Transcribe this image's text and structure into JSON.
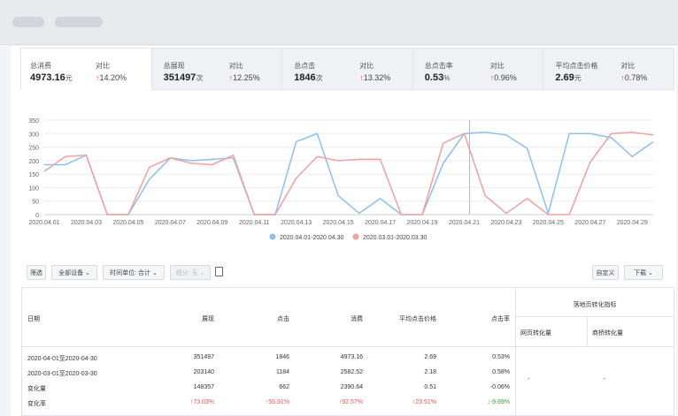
{
  "kpis": [
    {
      "label": "总消费",
      "value": "4973.16",
      "unit": "元",
      "compare_label": "对比",
      "arrow": "↑",
      "change": "14.20%"
    },
    {
      "label": "总展现",
      "value": "351497",
      "unit": "次",
      "compare_label": "对比",
      "arrow": "↑",
      "change": "12.25%"
    },
    {
      "label": "总点击",
      "value": "1846",
      "unit": "次",
      "compare_label": "对比",
      "arrow": "↑",
      "change": "13.32%"
    },
    {
      "label": "总点击率",
      "value": "0.53",
      "unit": "%",
      "compare_label": "对比",
      "arrow": "↑",
      "change": "0.96%"
    },
    {
      "label": "平均点击价格",
      "value": "2.69",
      "unit": "元",
      "compare_label": "对比",
      "arrow": "↑",
      "change": "0.78%"
    }
  ],
  "chart_data": {
    "type": "line",
    "x": [
      "2020.04.01",
      "2020.04.02",
      "2020.04.03",
      "2020.04.04",
      "2020.04.05",
      "2020.04.06",
      "2020.04.07",
      "2020.04.08",
      "2020.04.09",
      "2020.04.10",
      "2020.04.11",
      "2020.04.12",
      "2020.04.13",
      "2020.04.14",
      "2020.04.15",
      "2020.04.16",
      "2020.04.17",
      "2020.04.18",
      "2020.04.19",
      "2020.04.20",
      "2020.04.21",
      "2020.04.22",
      "2020.04.23",
      "2020.04.24",
      "2020.04.25",
      "2020.04.26",
      "2020.04.27",
      "2020.04.28",
      "2020.04.29",
      "2020.04.30"
    ],
    "xticks": [
      "2020.04.01",
      "2020.04.03",
      "2020.04.05",
      "2020.04.07",
      "2020.04.09",
      "2020.04.11",
      "2020.04.13",
      "2020.04.15",
      "2020.04.17",
      "2020.04.19",
      "2020.04.21",
      "2020.04.23",
      "2020.04.25",
      "2020.04.27",
      "2020.04.29"
    ],
    "yticks": [
      0,
      50,
      100,
      150,
      200,
      250,
      300,
      350
    ],
    "ylim": [
      0,
      350
    ],
    "series": [
      {
        "name": "2020.04.01-2020.04.30",
        "color": "#8fbfee",
        "values": [
          185,
          185,
          220,
          0,
          0,
          130,
          210,
          200,
          205,
          210,
          0,
          0,
          270,
          300,
          70,
          5,
          60,
          0,
          0,
          190,
          300,
          305,
          295,
          245,
          5,
          300,
          300,
          285,
          215,
          270
        ]
      },
      {
        "name": "2020.03.01-2020.03.30",
        "color": "#f0a0a0",
        "values": [
          160,
          215,
          220,
          0,
          0,
          175,
          210,
          190,
          185,
          220,
          0,
          0,
          135,
          215,
          200,
          205,
          205,
          0,
          0,
          265,
          300,
          70,
          5,
          60,
          0,
          0,
          195,
          300,
          305,
          295
        ]
      }
    ]
  },
  "toolbar": {
    "filter": "筛选",
    "device": "全部设备",
    "time_unit": "时间单位: 合计",
    "split": "细分: 无",
    "customize": "自定义",
    "download": "下载"
  },
  "table": {
    "headers": [
      "日期",
      "展现",
      "点击",
      "消费",
      "平均点击价格",
      "点击率"
    ],
    "group_header": "落地页转化指标",
    "sub_headers": [
      "网页转化量",
      "商桥转化量"
    ],
    "rows": [
      {
        "date": "2020-04-01至2020-04-30",
        "impr": "351497",
        "click": "1846",
        "cost": "4973.16",
        "cpc": "2.69",
        "ctr": "0.53%"
      },
      {
        "date": "2020-03-01至2020-03-30",
        "impr": "203140",
        "click": "1184",
        "cost": "2582.52",
        "cpc": "2.18",
        "ctr": "0.58%"
      },
      {
        "date": "变化量",
        "impr": "148357",
        "click": "662",
        "cost": "2390.64",
        "cpc": "0.51",
        "ctr": "-0.06%"
      },
      {
        "date": "变化率",
        "impr": "↑73.03%",
        "click": "↑55.91%",
        "cost": "↑92.57%",
        "cpc": "↑23.51%",
        "ctr": "↓-9.89%"
      }
    ],
    "dash": "-"
  }
}
